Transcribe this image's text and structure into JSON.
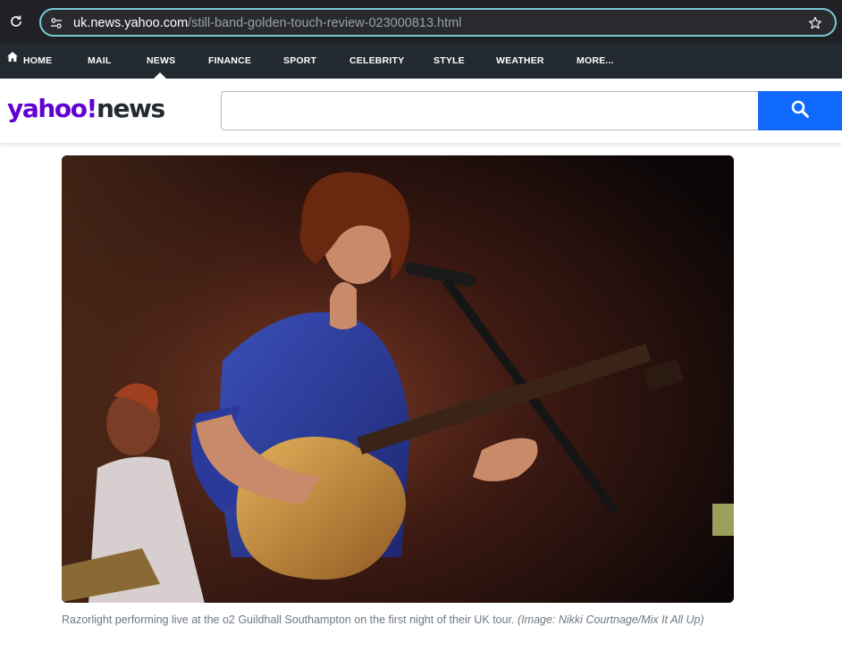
{
  "browser": {
    "url_host": "uk.news.yahoo.com",
    "url_path": "/still-band-golden-touch-review-023000813.html",
    "icons": [
      "reload-icon",
      "site-info-icon",
      "bookmark-star-icon"
    ]
  },
  "nav": {
    "items": [
      {
        "label": "HOME",
        "icon": "home-icon"
      },
      {
        "label": "MAIL"
      },
      {
        "label": "NEWS",
        "active": true
      },
      {
        "label": "FINANCE"
      },
      {
        "label": "SPORT"
      },
      {
        "label": "CELEBRITY"
      },
      {
        "label": "STYLE"
      },
      {
        "label": "WEATHER"
      },
      {
        "label": "MORE..."
      }
    ]
  },
  "header": {
    "logo_yahoo": "yahoo!",
    "logo_news": "news",
    "search_value": "",
    "search_icon": "search-icon"
  },
  "article": {
    "caption_text": "Razorlight performing live at the o2 Guildhall Southampton on the first night of their UK tour.",
    "caption_credit": "(Image: Nikki Courtnage/Mix It All Up)"
  },
  "colors": {
    "browser_bg": "#202124",
    "omnibox_border": "#7cc7d8",
    "nav_bg": "#232a31",
    "yahoo_purple": "#6001d2",
    "search_blue": "#0f69ff",
    "caption_gray": "#6e7780"
  }
}
